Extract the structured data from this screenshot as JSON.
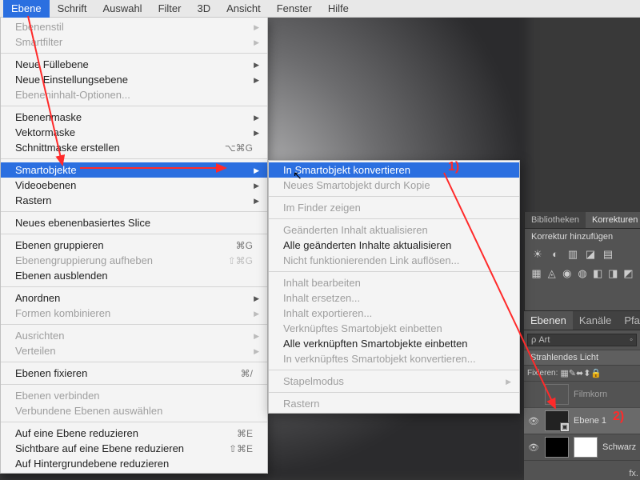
{
  "menubar": [
    "Ebene",
    "Schrift",
    "Auswahl",
    "Filter",
    "3D",
    "Ansicht",
    "Fenster",
    "Hilfe"
  ],
  "menubar_selected_index": 0,
  "dropdown": [
    {
      "label": "Ebenenstil",
      "dis": true,
      "sub": true
    },
    {
      "label": "Smartfilter",
      "dis": true,
      "sub": true
    },
    {
      "sep": true
    },
    {
      "label": "Neue Füllebene",
      "sub": true
    },
    {
      "label": "Neue Einstellungsebene",
      "sub": true
    },
    {
      "label": "Ebeneninhalt-Optionen...",
      "dis": true
    },
    {
      "sep": true
    },
    {
      "label": "Ebenenmaske",
      "sub": true
    },
    {
      "label": "Vektormaske",
      "sub": true
    },
    {
      "label": "Schnittmaske erstellen",
      "sc": "⌥⌘G"
    },
    {
      "sep": true
    },
    {
      "label": "Smartobjekte",
      "sub": true,
      "hi": true
    },
    {
      "label": "Videoebenen",
      "sub": true
    },
    {
      "label": "Rastern",
      "sub": true
    },
    {
      "sep": true
    },
    {
      "label": "Neues ebenenbasiertes Slice"
    },
    {
      "sep": true
    },
    {
      "label": "Ebenen gruppieren",
      "sc": "⌘G"
    },
    {
      "label": "Ebenengruppierung aufheben",
      "sc": "⇧⌘G",
      "dis": true
    },
    {
      "label": "Ebenen ausblenden"
    },
    {
      "sep": true
    },
    {
      "label": "Anordnen",
      "sub": true
    },
    {
      "label": "Formen kombinieren",
      "sub": true,
      "dis": true
    },
    {
      "sep": true
    },
    {
      "label": "Ausrichten",
      "sub": true,
      "dis": true
    },
    {
      "label": "Verteilen",
      "sub": true,
      "dis": true
    },
    {
      "sep": true
    },
    {
      "label": "Ebenen fixieren",
      "sc": "⌘/"
    },
    {
      "sep": true
    },
    {
      "label": "Ebenen verbinden",
      "dis": true
    },
    {
      "label": "Verbundene Ebenen auswählen",
      "dis": true
    },
    {
      "sep": true
    },
    {
      "label": "Auf eine Ebene reduzieren",
      "sc": "⌘E"
    },
    {
      "label": "Sichtbare auf eine Ebene reduzieren",
      "sc": "⇧⌘E"
    },
    {
      "label": "Auf Hintergrundebene reduzieren"
    }
  ],
  "submenu": [
    {
      "label": "In Smartobjekt konvertieren",
      "hi": true
    },
    {
      "label": "Neues Smartobjekt durch Kopie",
      "dis": true
    },
    {
      "sep": true
    },
    {
      "label": "Im Finder zeigen",
      "dis": true
    },
    {
      "sep": true
    },
    {
      "label": "Geänderten Inhalt aktualisieren",
      "dis": true
    },
    {
      "label": "Alle geänderten Inhalte aktualisieren"
    },
    {
      "label": "Nicht funktionierenden Link auflösen...",
      "dis": true
    },
    {
      "sep": true
    },
    {
      "label": "Inhalt bearbeiten",
      "dis": true
    },
    {
      "label": "Inhalt ersetzen...",
      "dis": true
    },
    {
      "label": "Inhalt exportieren...",
      "dis": true
    },
    {
      "label": "Verknüpftes Smartobjekt einbetten",
      "dis": true
    },
    {
      "label": "Alle verknüpften Smartobjekte einbetten"
    },
    {
      "label": "In verknüpftes Smartobjekt konvertieren...",
      "dis": true
    },
    {
      "sep": true
    },
    {
      "label": "Stapelmodus",
      "sub": true,
      "dis": true
    },
    {
      "sep": true
    },
    {
      "label": "Rastern",
      "dis": true
    }
  ],
  "adjust_tabs": [
    "Bibliotheken",
    "Korrekturen"
  ],
  "adjust_subtitle": "Korrektur hinzufügen",
  "adjust_row1": [
    "☀",
    "◐",
    "▥",
    "◪",
    "▤"
  ],
  "adjust_row2": [
    "▦",
    "◬",
    "◉",
    "◍",
    "◧",
    "◨",
    "◩"
  ],
  "layers_tabs": [
    "Ebenen",
    "Kanäle",
    "Pfade"
  ],
  "search_label": "Art",
  "lock_label": "Fixieren:",
  "lock_icons": [
    "▦",
    "✎",
    "⬌",
    "⬍",
    "🔒"
  ],
  "group_name": "Strahlendes Licht",
  "layer_hidden": "Filmkorn",
  "layer_sel": "Ebene 1",
  "layer_other": "Schwarz",
  "annotation1": "1)",
  "annotation2": "2)"
}
